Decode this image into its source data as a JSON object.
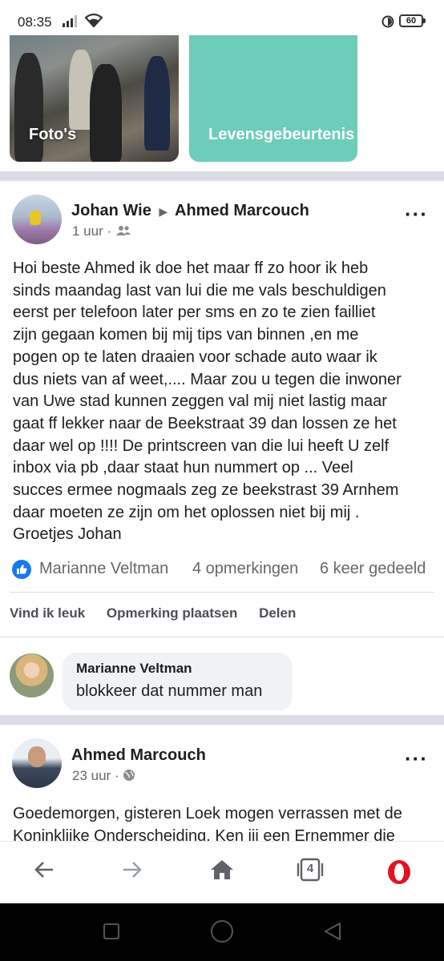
{
  "status_bar": {
    "time": "08:35",
    "battery": "60"
  },
  "top_cards": {
    "photos_label": "Foto's",
    "life_events_label": "Levensgebeurtenis"
  },
  "post1": {
    "author": "Johan Wie",
    "target": "Ahmed Marcouch",
    "time": "1 uur",
    "privacy_icon": "friends-icon",
    "lines": [
      "Hoi beste Ahmed ik doe het maar ff zo hoor ik heb",
      "sinds maandag last van lui die me vals beschuldigen",
      "eerst per telefoon later per sms en zo te zien failliet",
      "zijn gegaan komen bij mij tips van binnen ,en me",
      "pogen op te laten draaien voor schade auto waar ik",
      "dus niets van af weet,.... Maar zou u tegen die inwoner",
      "van Uwe stad kunnen zeggen val mij niet lastig maar",
      "gaat ff lekker naar de Beekstraat 39 dan lossen ze het",
      "daar wel op !!!! De printscreen van die lui heeft U zelf",
      "inbox via pb ,daar staat hun nummert op ... Veel",
      "succes ermee nogmaals zeg ze beekstrast 39 Arnhem",
      "daar moeten ze zijn om het oplossen niet bij mij .",
      "Groetjes Johan"
    ],
    "reaction_name": "Marianne Veltman",
    "comments": "4 opmerkingen",
    "shares": "6 keer gedeeld",
    "actions": {
      "like": "Vind ik leuk",
      "comment": "Opmerking plaatsen",
      "share": "Delen"
    },
    "top_comment": {
      "name": "Marianne Veltman",
      "text": "blokkeer dat nummer man"
    }
  },
  "post2": {
    "author": "Ahmed Marcouch",
    "time": "23 uur",
    "privacy_icon": "globe-icon",
    "lines": [
      "Goedemorgen, gisteren Loek mogen verrassen met de",
      "Koninklijke Onderscheiding. Ken jij een Ernemmer die"
    ]
  },
  "browser_bar": {
    "tab_count": "4"
  },
  "colors": {
    "accent": "#1877f2",
    "opera_red": "#e0141e",
    "life_card": "#6ccdb9"
  }
}
